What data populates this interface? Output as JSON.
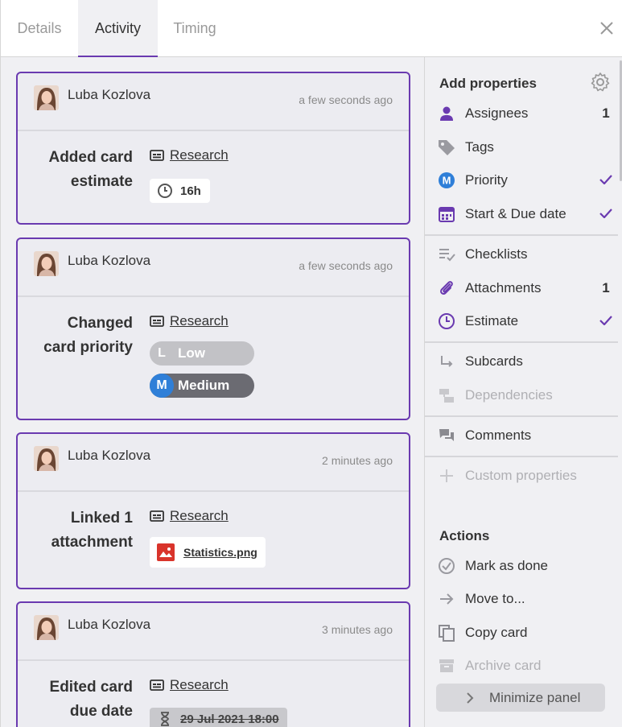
{
  "tabs": [
    {
      "label": "Details"
    },
    {
      "label": "Activity"
    },
    {
      "label": "Timing"
    }
  ],
  "activity": [
    {
      "author": "Luba Kozlova",
      "time": "a few seconds ago",
      "action_line1": "Added card",
      "action_line2": "estimate",
      "ref": "Research",
      "estimate": "16h"
    },
    {
      "author": "Luba Kozlova",
      "time": "a few seconds ago",
      "action_line1": "Changed",
      "action_line2": "card priority",
      "ref": "Research",
      "old_priority": {
        "mark": "L",
        "label": "Low"
      },
      "new_priority": {
        "mark": "M",
        "label": "Medium"
      }
    },
    {
      "author": "Luba Kozlova",
      "time": "2 minutes ago",
      "action_line1": "Linked 1",
      "action_line2": "attachment",
      "ref": "Research",
      "attachment": "Statistics.png"
    },
    {
      "author": "Luba Kozlova",
      "time": "3 minutes ago",
      "action_line1": "Edited card",
      "action_line2": "due date",
      "ref": "Research",
      "old_due": "29 Jul 2021 18:00"
    }
  ],
  "panel": {
    "add_title": "Add properties",
    "items": [
      {
        "label": "Assignees",
        "value": "1",
        "icon": "person-icon"
      },
      {
        "label": "Tags",
        "value": "",
        "icon": "tag-icon"
      },
      {
        "label": "Priority",
        "value": "",
        "icon": "priority-icon",
        "mark": "M"
      },
      {
        "label": "Start & Due date",
        "value": "",
        "icon": "calendar-icon"
      },
      {
        "label": "Checklists",
        "value": "",
        "icon": "checklist-icon"
      },
      {
        "label": "Attachments",
        "value": "1",
        "icon": "paperclip-icon"
      },
      {
        "label": "Estimate",
        "value": "",
        "icon": "clock-icon"
      },
      {
        "label": "Subcards",
        "value": "",
        "icon": "subcard-icon"
      },
      {
        "label": "Dependencies",
        "value": "",
        "icon": "dependencies-icon"
      },
      {
        "label": "Comments",
        "value": "",
        "icon": "comments-icon"
      },
      {
        "label": "Custom properties",
        "value": "",
        "icon": "plus-icon"
      }
    ],
    "actions_title": "Actions",
    "actions": [
      {
        "label": "Mark as done",
        "icon": "check-circle-icon"
      },
      {
        "label": "Move to...",
        "icon": "arrow-right-icon"
      },
      {
        "label": "Copy card",
        "icon": "copy-icon"
      },
      {
        "label": "Archive card",
        "icon": "archive-icon"
      }
    ],
    "minimize_label": "Minimize panel"
  },
  "colors": {
    "accent": "#6a3ab0",
    "priority_medium": "#2f7fd8",
    "attachment_red": "#d9342b"
  }
}
